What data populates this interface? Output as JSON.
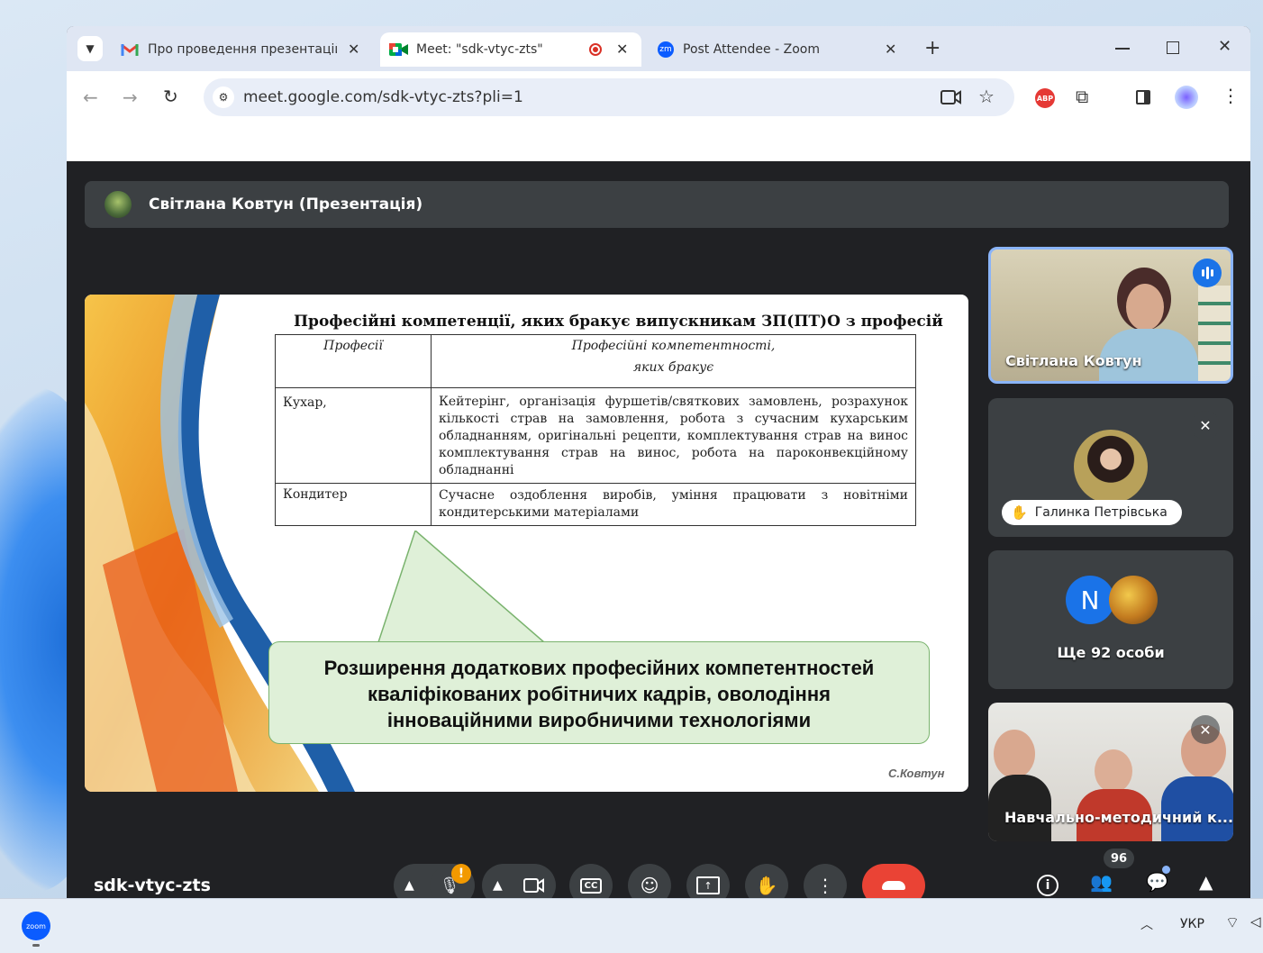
{
  "browser": {
    "tabs": [
      {
        "icon": "gmail-icon",
        "title": "Про проведення презентацій",
        "active": false
      },
      {
        "icon": "google-meet-icon",
        "title": "Meet: \"sdk-vtyc-zts\"",
        "active": true
      },
      {
        "icon": "zoom-icon",
        "title": "Post Attendee - Zoom",
        "active": false
      }
    ],
    "zoom_favicon_text": "zm",
    "url": "meet.google.com/sdk-vtyc-zts?pli=1",
    "extensions": {
      "adblock_label": "ABP"
    }
  },
  "meet": {
    "presenter_bar": "Світлана Ковтун (Презентація)",
    "slide": {
      "title": "Професійні компетенції, яких бракує випускникам ЗП(ПТ)О з професій",
      "table_headers": [
        "Професії",
        "Професійні компетентності,",
        "яких бракує"
      ],
      "rows": [
        {
          "profession": "Кухар,",
          "competences": "Кейтерінг, організація фуршетів/святкових замовлень, розрахунок кількості страв на замовлення, робота з сучасним кухарським обладнанням, оригінальні рецепти, комплектування страв на винос комплектування страв на винос, робота на пароконвекційному обладнанні"
        },
        {
          "profession": "Кондитер",
          "competences": "Сучасне оздоблення виробів, уміння працювати з новітніми кондитерськими матеріалами"
        }
      ],
      "callout_lines": [
        "Розширення додаткових професійних компетентностей",
        "кваліфікованих робітничих кадрів, оволодіння",
        "інноваційними виробничими технологіями"
      ],
      "author": "С.Ковтун"
    },
    "tiles": [
      {
        "name": "Світлана Ковтун",
        "speaking": true
      },
      {
        "name": "Галинка Петрівська",
        "hand_raised": true,
        "muted": true
      },
      {
        "name": "Ще 92 особи",
        "avatar_letter": "N"
      },
      {
        "name": "Навчально-методичний к...",
        "muted": true
      }
    ],
    "meeting_code": "sdk-vtyc-zts",
    "participants_count": "96",
    "mic_warning": "!"
  },
  "taskbar": {
    "language": "УКР",
    "zoom_label": "zoom"
  },
  "colors": {
    "accent_blue": "#1a73e8",
    "end_call_red": "#ea4335",
    "tab_strip": "#dfe6f3",
    "meet_bg": "#202124"
  }
}
